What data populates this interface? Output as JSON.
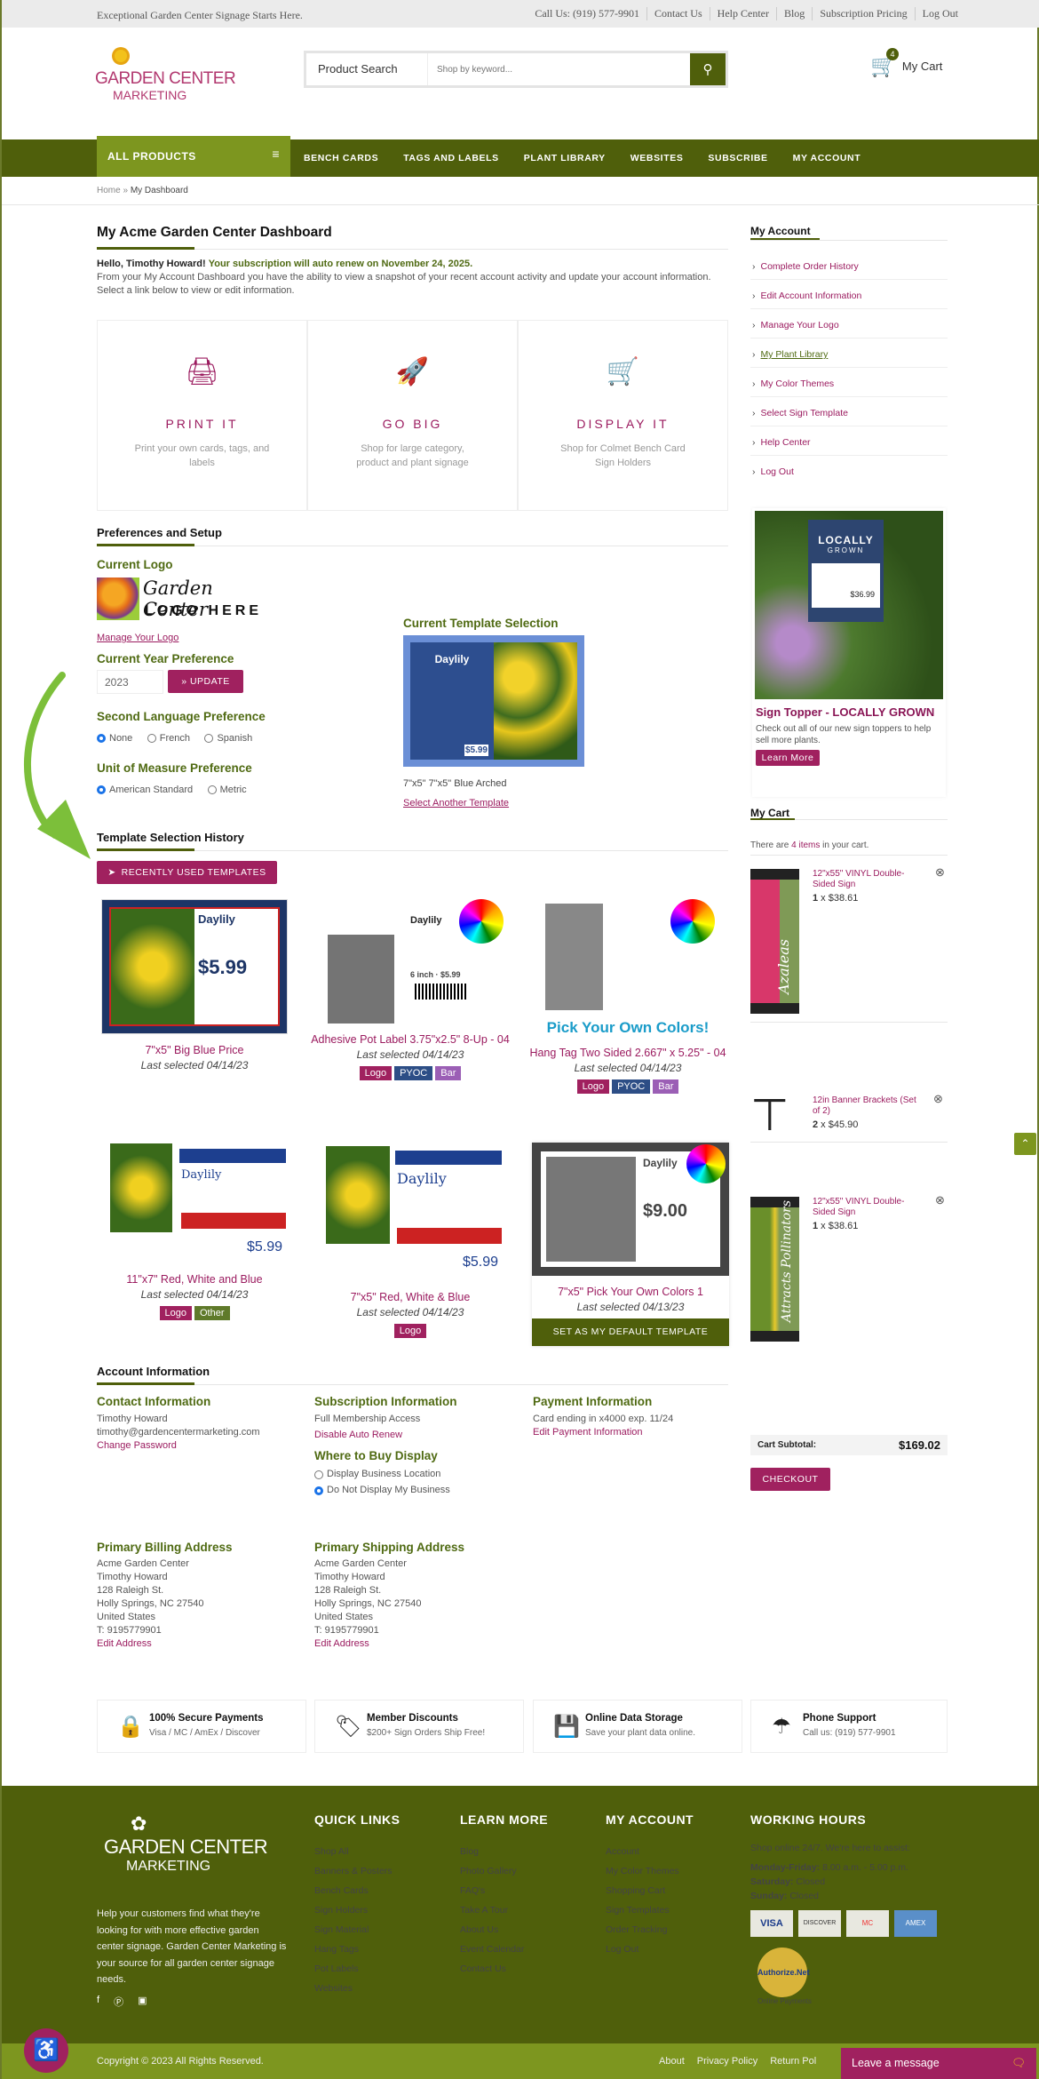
{
  "topbar": {
    "tagline": "Exceptional Garden Center Signage Starts Here.",
    "links": [
      "Call Us: (919) 577-9901",
      "Contact Us",
      "Help Center",
      "Blog",
      "Subscription Pricing",
      "Log Out"
    ]
  },
  "header": {
    "logo_line1": "GARDEN CENTER",
    "logo_line2": "MARKETING",
    "search_label": "Product Search",
    "search_placeholder": "Shop by keyword...",
    "cart_label": "My Cart",
    "cart_count": "4"
  },
  "nav": {
    "all_products": "ALL PRODUCTS",
    "items": [
      "BENCH CARDS",
      "TAGS AND LABELS",
      "PLANT LIBRARY",
      "WEBSITES",
      "SUBSCRIBE",
      "MY ACCOUNT"
    ]
  },
  "breadcrumb": {
    "home": "Home",
    "sep": "»",
    "current": "My Dashboard"
  },
  "dashboard": {
    "title": "My Acme Garden Center Dashboard",
    "hello": "Hello, Timothy Howard!",
    "renew": "Your subscription will auto renew on November 24, 2025.",
    "intro": "From your My Account Dashboard you have the ability to view a snapshot of your recent account activity and update your account information. Select a link below to view or edit information.",
    "cards": [
      {
        "icon": "printer-icon",
        "title": "PRINT IT",
        "desc": "Print your own cards, tags, and labels"
      },
      {
        "icon": "rocket-icon",
        "title": "GO BIG",
        "desc": "Shop for large category, product and plant signage"
      },
      {
        "icon": "cart-icon",
        "title": "DISPLAY IT",
        "desc": "Shop for Colmet Bench Card Sign Holders"
      }
    ]
  },
  "prefs": {
    "title": "Preferences and Setup",
    "current_logo": "Current Logo",
    "logo_script": "Garden Center",
    "logo_caps": "LOGO HERE",
    "manage_logo": "Manage Your Logo",
    "year_label": "Current Year Preference",
    "year_value": "2023",
    "update": "» UPDATE",
    "lang_label": "Second Language Preference",
    "lang_options": [
      "None",
      "French",
      "Spanish"
    ],
    "lang_selected": "None",
    "unit_label": "Unit of Measure Preference",
    "unit_options": [
      "American Standard",
      "Metric"
    ],
    "unit_selected": "American Standard",
    "template_label": "Current Template Selection",
    "template_name": "7\"x5\" 7\"x5\" Blue Arched",
    "select_another": "Select Another Template",
    "template_preview": {
      "title": "Daylily",
      "price": "$5.99"
    }
  },
  "history": {
    "title": "Template Selection History",
    "button": "RECENTLY USED TEMPLATES",
    "items": [
      {
        "name": "7\"x5\" Big Blue Price",
        "last": "Last selected 04/14/23",
        "tags": [],
        "preview_price": "$5.99",
        "preview_title": "Daylily"
      },
      {
        "name": "Adhesive Pot Label 3.75\"x2.5\" 8-Up - 04",
        "last": "Last selected 04/14/23",
        "tags": [
          "Logo",
          "PYOC",
          "Bar"
        ],
        "preview_title": "Daylily",
        "preview_price": "6 inch · $5.99"
      },
      {
        "name": "Hang Tag Two Sided 2.667\" x 5.25\" - 04",
        "last": "Last selected 04/14/23",
        "tags": [
          "Logo",
          "PYOC",
          "Bar"
        ],
        "preview_title": "Pick Your Own Colors!"
      },
      {
        "name": "11\"x7\" Red, White and Blue",
        "last": "Last selected 04/14/23",
        "tags": [
          "Logo",
          "Other"
        ],
        "preview_title": "Daylily",
        "preview_price": "$5.99"
      },
      {
        "name": "7\"x5\" Red, White & Blue",
        "last": "Last selected 04/14/23",
        "tags": [
          "Logo"
        ],
        "preview_title": "Daylily",
        "preview_price": "$5.99"
      },
      {
        "name": "7\"x5\" Pick Your Own Colors 1",
        "last": "Last selected 04/13/23",
        "tags": [],
        "preview_title": "Daylily",
        "preview_price": "$9.00",
        "default_button": "SET AS MY DEFAULT TEMPLATE"
      }
    ],
    "tag_colors": {
      "Logo": "#a0215f",
      "PYOC": "#2d4e86",
      "Bar": "#9b5fb5",
      "Other": "#5f7a2a"
    }
  },
  "account": {
    "title": "Account Information",
    "contact": {
      "title": "Contact Information",
      "name": "Timothy Howard",
      "email": "timothy@gardencentermarketing.com",
      "link": "Change Password"
    },
    "subscription": {
      "title": "Subscription Information",
      "plan": "Full Membership Access",
      "link": "Disable Auto Renew"
    },
    "where": {
      "title": "Where to Buy Display",
      "options": [
        "Display Business Location",
        "Do Not Display My Business"
      ],
      "selected": "Do Not Display My Business"
    },
    "payment": {
      "title": "Payment Information",
      "card": "Card ending in x4000 exp. 11/24",
      "link": "Edit Payment Information"
    },
    "billing": {
      "title": "Primary Billing Address",
      "lines": [
        "Acme Garden Center",
        "Timothy Howard",
        "128 Raleigh St.",
        "Holly Springs, NC 27540",
        "United States",
        "T: 9195779901"
      ],
      "link": "Edit Address"
    },
    "shipping": {
      "title": "Primary Shipping Address",
      "lines": [
        "Acme Garden Center",
        "Timothy Howard",
        "128 Raleigh St.",
        "Holly Springs, NC 27540",
        "United States",
        "T: 9195779901"
      ],
      "link": "Edit Address"
    }
  },
  "sidebar": {
    "title": "My Account",
    "items": [
      "Complete Order History",
      "Edit Account Information",
      "Manage Your Logo",
      "My Plant Library",
      "My Color Themes",
      "Select Sign Template",
      "Help Center",
      "Log Out"
    ],
    "promo": {
      "sign_line1": "LOCALLY",
      "sign_line2": "GROWN",
      "sign_price": "$36.99",
      "title": "Sign Topper - LOCALLY GROWN",
      "text": "Check out all of our new sign toppers to help sell more plants.",
      "button": "Learn More"
    }
  },
  "cart": {
    "title": "My Cart",
    "summary_pre": "There are ",
    "summary_count": "4 items",
    "summary_post": " in your cart.",
    "items": [
      {
        "name": "12\"x55\" VINYL Double-Sided Sign",
        "qty": "1",
        "price": "$38.61",
        "image_text": "Azaleas"
      },
      {
        "name": "12in Banner Brackets (Set of 2)",
        "qty": "2",
        "price": "$45.90"
      },
      {
        "name": "12\"x55\" VINYL Double-Sided Sign",
        "qty": "1",
        "price": "$38.61",
        "image_text": "Attracts Pollinators"
      }
    ],
    "subtotal_label": "Cart Subtotal:",
    "subtotal": "$169.02",
    "checkout": "CHECKOUT"
  },
  "features": [
    {
      "icon": "lock-icon",
      "title": "100% Secure Payments",
      "text": "Visa / MC / AmEx / Discover"
    },
    {
      "icon": "tag-icon",
      "title": "Member Discounts",
      "text": "$200+ Sign Orders Ship Free!"
    },
    {
      "icon": "floppy-disk-icon",
      "title": "Online Data Storage",
      "text": "Save your plant data online."
    },
    {
      "icon": "umbrella-icon",
      "title": "Phone Support",
      "text": "Call us: (919) 577-9901"
    }
  ],
  "footer": {
    "about": "Help your customers find what they're looking for with more effective garden center signage. Garden Center Marketing is your source for all garden center signage needs.",
    "quick_links": {
      "title": "QUICK LINKS",
      "items": [
        "Shop All",
        "Banners & Posters",
        "Bench Cards",
        "Sign Holders",
        "Sign Material",
        "Hang Tags",
        "Pot Labels",
        "Websites"
      ]
    },
    "learn_more": {
      "title": "LEARN MORE",
      "items": [
        "Blog",
        "Photo Gallery",
        "FAQ's",
        "Take A Tour",
        "About Us",
        "Event Calendar",
        "Contact Us"
      ]
    },
    "my_account": {
      "title": "MY ACCOUNT",
      "items": [
        "Account",
        "My Color Themes",
        "Shopping Cart",
        "Sign Templates",
        "Order Tracking",
        "Log Out"
      ]
    },
    "hours": {
      "title": "WORKING HOURS",
      "intro": "Shop online 24/7. We're here to assist:",
      "rows": [
        {
          "day": "Monday-Friday:",
          "time": " 8.00 a.m. - 5.00 p.m."
        },
        {
          "day": "Saturday:",
          "time": " Closed"
        },
        {
          "day": "Sunday:",
          "time": " Closed"
        }
      ],
      "cards": [
        "VISA",
        "DISCOVER",
        "MC",
        "AMEX"
      ],
      "badge": "Authorize.Net",
      "badge_sub": "Online Payments"
    },
    "copyright": "Copyright © 2023 All Rights Reserved.",
    "bottom_links": [
      "About",
      "Privacy Policy",
      "Return Pol"
    ],
    "chat": "Leave a message"
  },
  "colors": {
    "olive": "#4f5f0b",
    "light_olive": "#7d961f",
    "accent": "#a0215f",
    "heading_green": "#4f6a12"
  }
}
